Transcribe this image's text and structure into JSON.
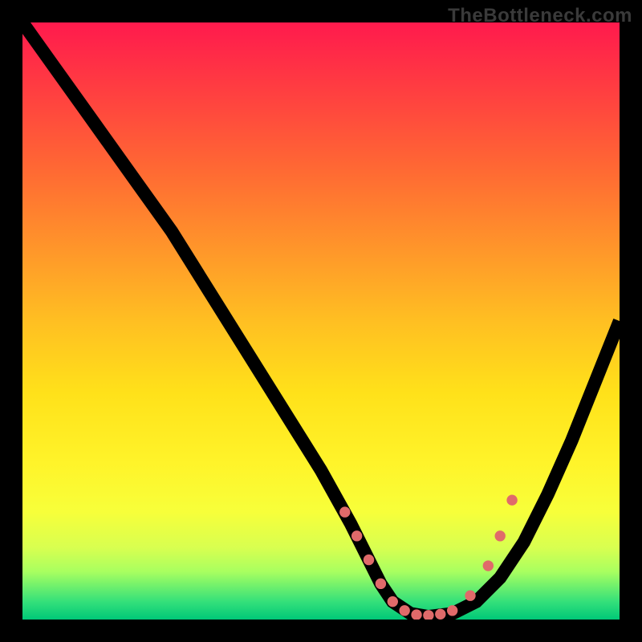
{
  "watermark": "TheBottleneck.com",
  "chart_data": {
    "type": "line",
    "title": "",
    "xlabel": "",
    "ylabel": "",
    "xlim": [
      0,
      100
    ],
    "ylim": [
      0,
      100
    ],
    "series": [
      {
        "name": "curve",
        "x": [
          0,
          5,
          10,
          15,
          20,
          25,
          30,
          35,
          40,
          45,
          50,
          55,
          58,
          60,
          62,
          65,
          68,
          72,
          76,
          80,
          84,
          88,
          92,
          96,
          100
        ],
        "values": [
          100,
          93,
          86,
          79,
          72,
          65,
          57,
          49,
          41,
          33,
          25,
          16,
          10,
          6,
          3,
          1,
          0.5,
          1,
          3,
          7,
          13,
          21,
          30,
          40,
          50
        ]
      }
    ],
    "markers": {
      "name": "dots",
      "x": [
        54,
        56,
        58,
        60,
        62,
        64,
        66,
        68,
        70,
        72,
        75,
        78,
        80,
        82
      ],
      "values": [
        18,
        14,
        10,
        6,
        3,
        1.5,
        0.8,
        0.7,
        0.9,
        1.5,
        4,
        9,
        14,
        20
      ]
    },
    "background_gradient": {
      "top": "#ff1a4d",
      "mid": "#ffe11a",
      "bottom": "#00c878"
    }
  }
}
